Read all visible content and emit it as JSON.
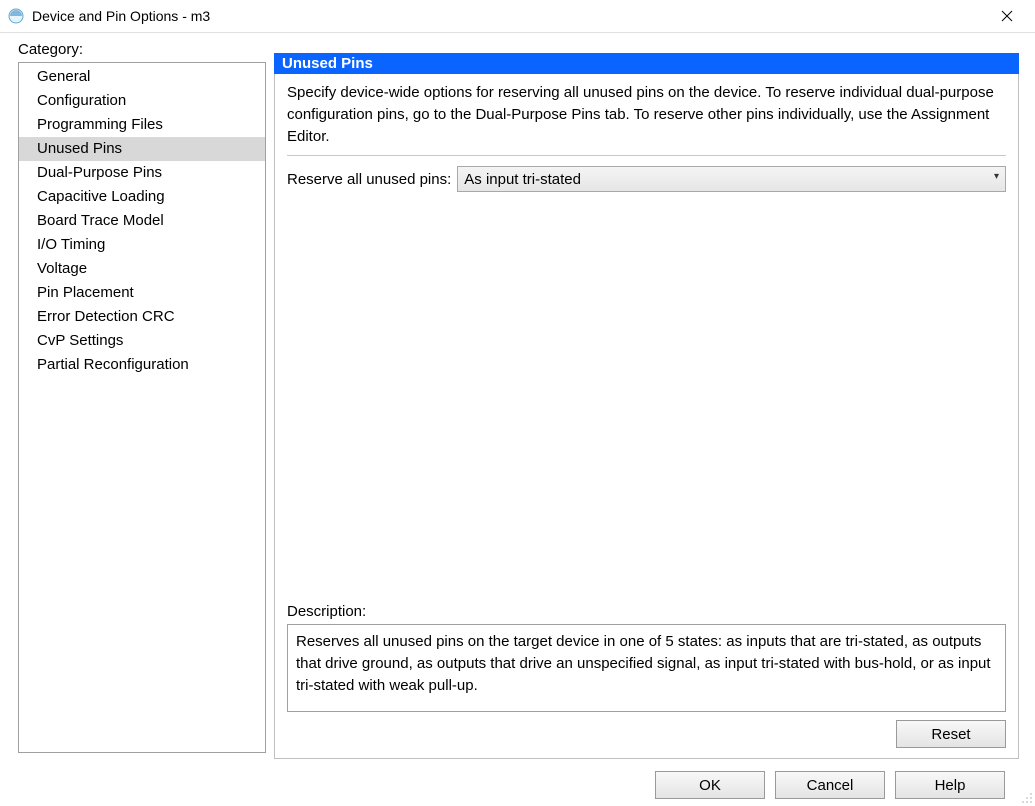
{
  "window": {
    "title": "Device and Pin Options - m3"
  },
  "category": {
    "label": "Category:",
    "selectedIndex": 3,
    "items": [
      "General",
      "Configuration",
      "Programming Files",
      "Unused Pins",
      "Dual-Purpose Pins",
      "Capacitive Loading",
      "Board Trace Model",
      "I/O Timing",
      "Voltage",
      "Pin Placement",
      "Error Detection CRC",
      "CvP Settings",
      "Partial Reconfiguration"
    ]
  },
  "panel": {
    "title": "Unused Pins",
    "intro": "Specify device-wide options for reserving all unused pins on the device. To reserve individual dual-purpose configuration pins, go to the Dual-Purpose Pins tab. To reserve other pins individually, use the Assignment Editor.",
    "reserve": {
      "label": "Reserve all unused pins:",
      "value": "As input tri-stated"
    },
    "description": {
      "label": "Description:",
      "text": "Reserves all unused pins on the target device in one of 5 states: as inputs that are tri-stated, as outputs that drive ground, as outputs that drive an unspecified signal, as input tri-stated with bus-hold, or as input tri-stated with weak pull-up."
    },
    "reset_label": "Reset"
  },
  "buttons": {
    "ok": "OK",
    "cancel": "Cancel",
    "help": "Help"
  }
}
